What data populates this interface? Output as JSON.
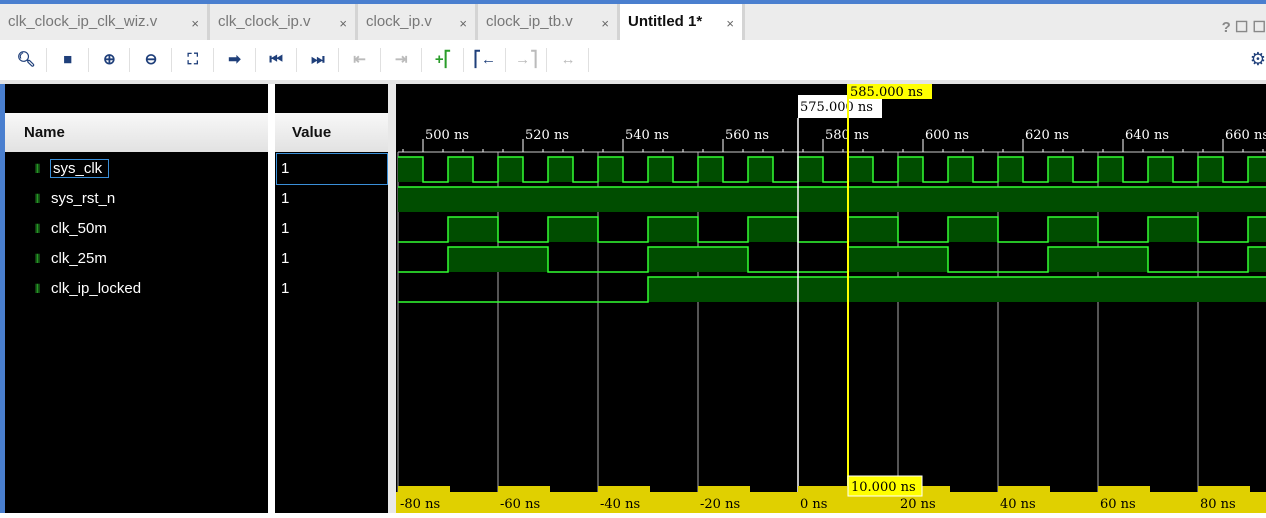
{
  "tabs": [
    {
      "label": "clk_clock_ip_clk_wiz.v",
      "active": false
    },
    {
      "label": "clk_clock_ip.v",
      "active": false
    },
    {
      "label": "clock_ip.v",
      "active": false
    },
    {
      "label": "clock_ip_tb.v",
      "active": false
    },
    {
      "label": "Untitled 1*",
      "active": true
    }
  ],
  "tab_close": "×",
  "window_buttons": "? ☐ ☐",
  "toolbar": [
    {
      "icon": "search-icon",
      "glyph": "🔍︎"
    },
    {
      "icon": "save-icon",
      "glyph": "■"
    },
    {
      "icon": "zoom-in-icon",
      "glyph": "⊕"
    },
    {
      "icon": "zoom-out-icon",
      "glyph": "⊖"
    },
    {
      "icon": "zoom-fit-icon",
      "glyph": "⛶"
    },
    {
      "icon": "go-to-cursor-icon",
      "glyph": "➡"
    },
    {
      "icon": "go-to-start-icon",
      "glyph": "⏮"
    },
    {
      "icon": "go-to-end-icon",
      "glyph": "⏭"
    },
    {
      "icon": "previous-transition-icon",
      "glyph": "⇤"
    },
    {
      "icon": "next-transition-icon",
      "glyph": "⇥"
    },
    {
      "icon": "add-marker-icon",
      "glyph": "+⎡"
    },
    {
      "icon": "previous-marker-icon",
      "glyph": "⎡←"
    },
    {
      "icon": "next-marker-icon",
      "glyph": "→⎤"
    },
    {
      "icon": "swap-cursors-icon",
      "glyph": "↔"
    }
  ],
  "settings_icon": "⚙",
  "columns": {
    "name": "Name",
    "value": "Value"
  },
  "signals": [
    {
      "name": "sys_clk",
      "value": "1",
      "kind": "input",
      "wave": {
        "type": "clock",
        "period": 10,
        "high_phase": 5
      }
    },
    {
      "name": "sys_rst_n",
      "value": "1",
      "kind": "input",
      "wave": {
        "type": "const",
        "level": 1
      }
    },
    {
      "name": "clk_50m",
      "value": "1",
      "kind": "output",
      "wave": {
        "type": "clock",
        "period": 20,
        "high_phase": 505
      }
    },
    {
      "name": "clk_25m",
      "value": "1",
      "kind": "output",
      "wave": {
        "type": "clock",
        "period": 40,
        "high_phase": 505
      }
    },
    {
      "name": "clk_ip_locked",
      "value": "1",
      "kind": "output",
      "wave": {
        "type": "step",
        "rise": 545
      }
    }
  ],
  "time_range_ns": [
    495,
    668.6
  ],
  "ruler_labels": [
    "500 ns",
    "520 ns",
    "540 ns",
    "560 ns",
    "580 ns",
    "600 ns",
    "620 ns",
    "640 ns",
    "660 ns"
  ],
  "ruler_ticks_ns": [
    500,
    520,
    540,
    560,
    580,
    600,
    620,
    640,
    660
  ],
  "cursor": {
    "label": "585.000 ns",
    "time": 585,
    "color": "#ffff00"
  },
  "marker": {
    "label": "575.000 ns",
    "time": 575
  },
  "delta": {
    "label": "10.000 ns"
  },
  "relative_labels": [
    "-80 ns",
    "-60 ns",
    "-40 ns",
    "-20 ns",
    "0 ns",
    "20 ns",
    "40 ns",
    "60 ns",
    "80 ns"
  ],
  "relative_ticks_ns": [
    -80,
    -60,
    -40,
    -20,
    0,
    20,
    40,
    60,
    80
  ],
  "colors": {
    "wave_line": "#33ff33",
    "wave_fill": "#004d00",
    "cursor": "#ffff00",
    "relative_band": "#e0d000"
  }
}
